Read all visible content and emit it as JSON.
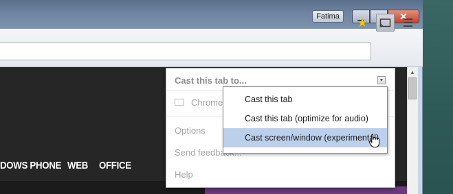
{
  "titlebar": {
    "profile_name": "Fatima",
    "minimize_glyph": "▁",
    "maximize_glyph": "□",
    "close_glyph": "✕"
  },
  "toolbar": {
    "bookmark_icon": "★"
  },
  "page": {
    "nav_items": [
      "DOWS PHONE",
      "WEB",
      "OFFICE"
    ]
  },
  "cast_bubble": {
    "title": "Cast this tab to...",
    "device_label": "Chromec",
    "links": [
      "Options",
      "Send feedback...",
      "Help"
    ]
  },
  "cast_mode_menu": {
    "items": [
      {
        "label": "Cast this tab",
        "selected": false
      },
      {
        "label": "Cast this tab (optimize for audio)",
        "selected": false
      },
      {
        "label": "Cast screen/window (experimental)",
        "selected": true
      }
    ]
  },
  "colors": {
    "selected_item": "#bcd0ec",
    "close_button": "#c0442d",
    "bookmark_star": "#f2c21a"
  }
}
